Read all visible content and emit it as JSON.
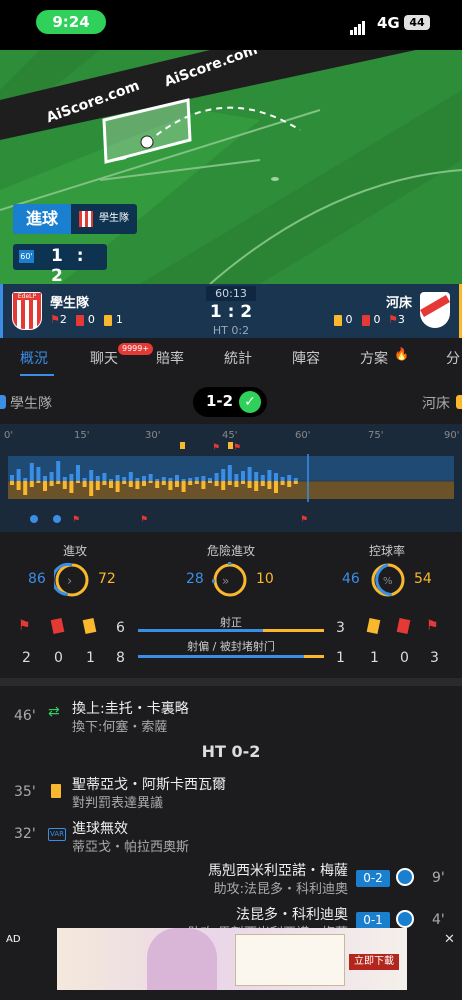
{
  "status_bar": {
    "time": "9:24",
    "network": "4G",
    "battery": "44"
  },
  "field": {
    "watermark": "AiScore.com",
    "event_label": "進球",
    "event_team": "學生隊",
    "mini_minute": "60'",
    "mini_home": "1",
    "mini_sep": ":",
    "mini_away": "2"
  },
  "header": {
    "home": {
      "name": "學生隊",
      "crest_text": "EdeLP",
      "corners": "2",
      "reds": "0",
      "yellows": "1"
    },
    "away": {
      "name": "河床",
      "yellows": "0",
      "reds": "0",
      "corners": "3"
    },
    "clock": "60:13",
    "score": "1 : 2",
    "half_time": "HT 0:2"
  },
  "tabs": [
    {
      "label": "概況"
    },
    {
      "label": "聊天"
    },
    {
      "label": "賠率"
    },
    {
      "label": "統計"
    },
    {
      "label": "陣容"
    },
    {
      "label": "方案"
    },
    {
      "label": "分"
    }
  ],
  "chat_badge": "9999+",
  "result": {
    "home": "學生隊",
    "score": "1-2",
    "away": "河床"
  },
  "timeline": {
    "ticks": [
      "0'",
      "15'",
      "30'",
      "45'",
      "60'",
      "75'",
      "90'"
    ]
  },
  "stats": {
    "attack": {
      "label": "進攻",
      "home": "86",
      "away": "72"
    },
    "dangerous": {
      "label": "危險進攻",
      "home": "28",
      "away": "10"
    },
    "possession": {
      "label": "控球率",
      "home": "46",
      "away": "54",
      "symbol": "%"
    },
    "on_target": {
      "label": "射正",
      "home": "6",
      "away": "3",
      "home_fraction": 0.67
    },
    "off_target": {
      "label": "射偏 / 被封堵射门",
      "home": "8",
      "away": "1",
      "home_fraction": 0.89
    },
    "home_counts": {
      "corners": "2",
      "reds": "0",
      "yellows": "1"
    },
    "away_counts": {
      "yellows": "1",
      "reds": "0",
      "corners": "3"
    }
  },
  "events": [
    {
      "minute": "46'",
      "main": "換上:圭托・卡裏略",
      "sub": "換下:何塞・索薩"
    },
    {
      "divider": "HT 0-2"
    },
    {
      "minute": "35'",
      "main": "聖蒂亞戈・阿斯卡西瓦爾",
      "sub": "對判罰表達異議"
    },
    {
      "minute": "32'",
      "icon": "VAR",
      "main": "進球無效",
      "sub": "蒂亞戈・帕拉西奧斯"
    },
    {
      "minute": "9'",
      "main": "馬剋西米利亞諾・梅薩",
      "sub": "助攻:法昆多・科利迪奧",
      "score": "0-2"
    },
    {
      "minute": "4'",
      "main": "法昆多・科利迪奧",
      "sub": "助攻:馬剋西米利亞諾・梅薩",
      "score": "0-1"
    }
  ],
  "ad": {
    "label": "AD",
    "cta": "立即下載"
  },
  "colors": {
    "home": "#3a8ee6",
    "away": "#f9b82e",
    "red_card": "#e53935",
    "accent": "#2fd15a"
  }
}
